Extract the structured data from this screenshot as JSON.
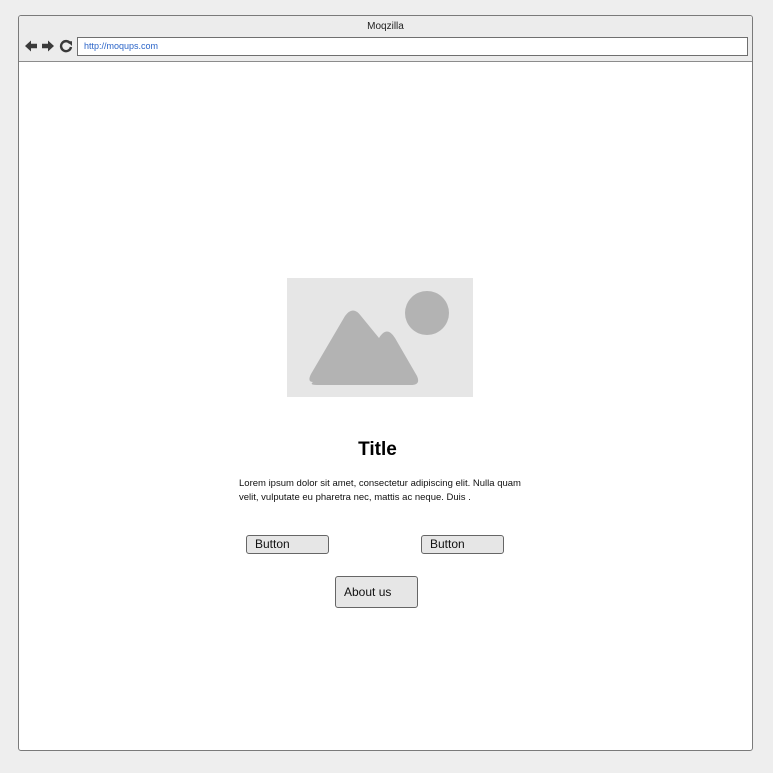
{
  "window": {
    "title": "Moqzilla"
  },
  "toolbar": {
    "back_icon": "arrow-left-icon",
    "forward_icon": "arrow-right-icon",
    "reload_icon": "reload-icon",
    "address": "http://moqups.com"
  },
  "content": {
    "image_icon": "image-placeholder-icon",
    "title": "Title",
    "paragraph": "Lorem ipsum dolor sit amet, consectetur adipiscing elit. Nulla quam velit, vulputate eu pharetra nec, mattis ac neque. Duis .",
    "button_left_label": "Button",
    "button_right_label": "Button",
    "about_label": "About us"
  },
  "colors": {
    "chrome_bg": "#ececec",
    "address_text": "#2a64c8",
    "button_bg": "#e6e6e6",
    "placeholder_bg": "#e6e6e6",
    "placeholder_shape": "#b3b3b3"
  }
}
